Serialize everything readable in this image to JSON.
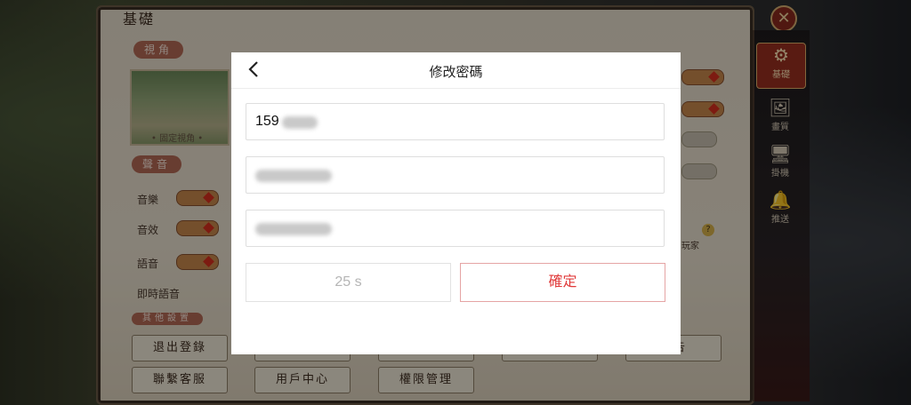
{
  "background": {
    "panel_title": "基礎",
    "close_icon": "close-icon",
    "sidebar": [
      {
        "label": "基礎",
        "icon": "gear-icon",
        "glyph": "⚙",
        "active": true
      },
      {
        "label": "畫質",
        "icon": "image-icon",
        "glyph": "🖼",
        "active": false
      },
      {
        "label": "掛機",
        "icon": "monitor-icon",
        "glyph": "🖥",
        "active": false
      },
      {
        "label": "推送",
        "icon": "bell-icon",
        "glyph": "🔔",
        "active": false
      }
    ],
    "sections": {
      "view": "視角",
      "sound": "聲音",
      "other": "其他設置"
    },
    "view_caption": "• 固定視角 •",
    "sound_rows": [
      "音樂",
      "音效",
      "語音",
      "即時語音"
    ],
    "side_text": "玩家",
    "buttons_row1": [
      "退出登錄",
      "",
      "",
      "",
      "公告"
    ],
    "buttons_row2": [
      "聯繫客服",
      "用戶中心",
      "權限管理"
    ]
  },
  "dialog": {
    "title": "修改密碼",
    "back_icon": "chevron-left-icon",
    "phone_value": "159",
    "countdown_label": "25 s",
    "confirm_label": "確定"
  },
  "colors": {
    "accent": "#e03a3a",
    "accent_border": "#e5a4a4",
    "disabled_text": "#b5b5b5"
  }
}
